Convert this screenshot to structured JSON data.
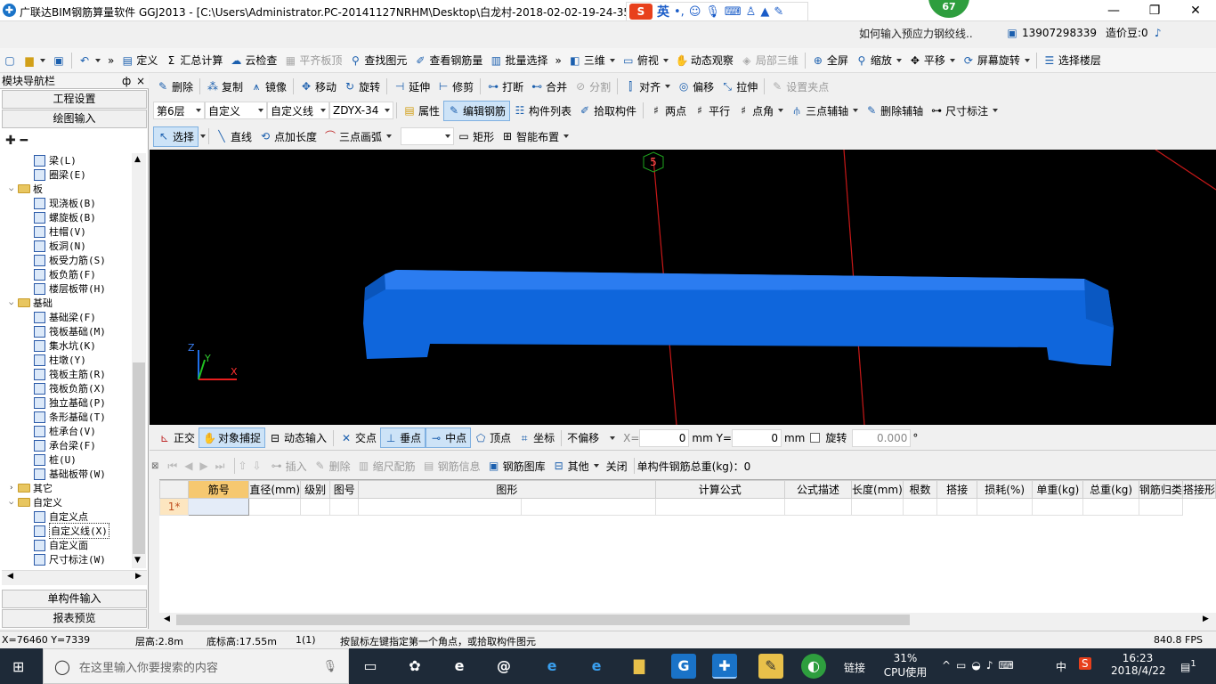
{
  "title_bar": {
    "app_title": "广联达BIM钢筋算量软件 GGJ2013 - [C:\\Users\\Administrator.PC-20141127NRHM\\Desktop\\白龙村-2018-02-02-19-24-35",
    "ime_s": "S",
    "ime_mode": "英",
    "notify_badge": "67"
  },
  "menu_row": {
    "items": [
      "定义",
      "汇总计算",
      "云检查",
      "平齐板顶",
      "查找图元",
      "查看钢筋量",
      "批量选择",
      "三维",
      "俯视",
      "动态观察",
      "局部三维",
      "全屏",
      "缩放",
      "平移",
      "屏幕旋转",
      "选择楼层"
    ],
    "help_link": "如何输入预应力钢绞线..",
    "phone": "13907298339",
    "beans": "造价豆:0"
  },
  "edit_row": {
    "items": [
      "删除",
      "复制",
      "镜像",
      "移动",
      "旋转",
      "延伸",
      "修剪",
      "打断",
      "合并",
      "分割",
      "对齐",
      "偏移",
      "拉伸",
      "设置夹点"
    ]
  },
  "layer_row": {
    "floor": "第6层",
    "category": "自定义",
    "type": "自定义线",
    "name": "ZDYX-34",
    "items": [
      "属性",
      "编辑钢筋",
      "构件列表",
      "拾取构件",
      "两点",
      "平行",
      "点角",
      "三点辅轴",
      "删除辅轴",
      "尺寸标注"
    ]
  },
  "draw_row": {
    "items": [
      "选择",
      "直线",
      "点加长度",
      "三点画弧",
      "矩形",
      "智能布置"
    ]
  },
  "nav": {
    "title": "模块导航栏",
    "pin": "ф",
    "close": "×",
    "buttons": [
      "工程设置",
      "绘图输入"
    ],
    "bottom_buttons": [
      "单构件输入",
      "报表预览"
    ],
    "tree": [
      {
        "level": 2,
        "label": "梁(L)"
      },
      {
        "level": 2,
        "label": "圈梁(E)"
      },
      {
        "level": 1,
        "label": "板",
        "folder": true,
        "open": true
      },
      {
        "level": 2,
        "label": "现浇板(B)"
      },
      {
        "level": 2,
        "label": "螺旋板(B)"
      },
      {
        "level": 2,
        "label": "柱帽(V)"
      },
      {
        "level": 2,
        "label": "板洞(N)"
      },
      {
        "level": 2,
        "label": "板受力筋(S)"
      },
      {
        "level": 2,
        "label": "板负筋(F)"
      },
      {
        "level": 2,
        "label": "楼层板带(H)"
      },
      {
        "level": 1,
        "label": "基础",
        "folder": true,
        "open": true
      },
      {
        "level": 2,
        "label": "基础梁(F)"
      },
      {
        "level": 2,
        "label": "筏板基础(M)"
      },
      {
        "level": 2,
        "label": "集水坑(K)"
      },
      {
        "level": 2,
        "label": "柱墩(Y)"
      },
      {
        "level": 2,
        "label": "筏板主筋(R)"
      },
      {
        "level": 2,
        "label": "筏板负筋(X)"
      },
      {
        "level": 2,
        "label": "独立基础(P)"
      },
      {
        "level": 2,
        "label": "条形基础(T)"
      },
      {
        "level": 2,
        "label": "桩承台(V)"
      },
      {
        "level": 2,
        "label": "承台梁(F)"
      },
      {
        "level": 2,
        "label": "桩(U)"
      },
      {
        "level": 2,
        "label": "基础板带(W)"
      },
      {
        "level": 1,
        "label": "其它",
        "folder": true,
        "open": false
      },
      {
        "level": 1,
        "label": "自定义",
        "folder": true,
        "open": true
      },
      {
        "level": 2,
        "label": "自定义点"
      },
      {
        "level": 2,
        "label": "自定义线(X)",
        "selected": true
      },
      {
        "level": 2,
        "label": "自定义面"
      },
      {
        "level": 2,
        "label": "尺寸标注(W)"
      }
    ]
  },
  "viewport": {
    "axis_label": "5",
    "axis_x": "X",
    "axis_y": "Y",
    "axis_z": "Z",
    "beam_color": "#0a63d6",
    "axis_line_color": "#d01818"
  },
  "snap_row": {
    "items": [
      "正交",
      "对象捕捉",
      "动态输入",
      "交点",
      "垂点",
      "中点",
      "顶点",
      "坐标"
    ],
    "offset_mode": "不偏移",
    "x_label": "X=",
    "x_value": "0",
    "y_label": "mm Y=",
    "y_value": "0",
    "unit": "mm",
    "rotate_label": "旋转",
    "rotate_value": "0.000",
    "degree": "°"
  },
  "rebar_toolbar": {
    "items": [
      "插入",
      "删除",
      "缩尺配筋",
      "钢筋信息",
      "钢筋图库",
      "其他",
      "关闭"
    ],
    "total": "单构件钢筋总重(kg)：0"
  },
  "rebar_table": {
    "columns": [
      "筋号",
      "直径(mm)",
      "级别",
      "图号",
      "图形",
      "计算公式",
      "公式描述",
      "长度(mm)",
      "根数",
      "搭接",
      "损耗(%)",
      "单重(kg)",
      "总重(kg)",
      "钢筋归类",
      "搭接形"
    ],
    "rows": [
      {
        "index": "1*"
      }
    ]
  },
  "status": {
    "coords": "X=76460 Y=7339",
    "floor_height": "层高:2.8m",
    "base_height": "底标高:17.55m",
    "count": "1(1)",
    "hint": "按鼠标左键指定第一个角点，或拾取构件图元",
    "fps": "840.8 FPS"
  },
  "taskbar": {
    "search_placeholder": "在这里输入你要搜索的内容",
    "link_label": "链接",
    "cpu_percent": "31%",
    "cpu_label": "CPU使用",
    "lang": "中",
    "time": "16:23",
    "date": "2018/4/22",
    "notifications": "1"
  }
}
